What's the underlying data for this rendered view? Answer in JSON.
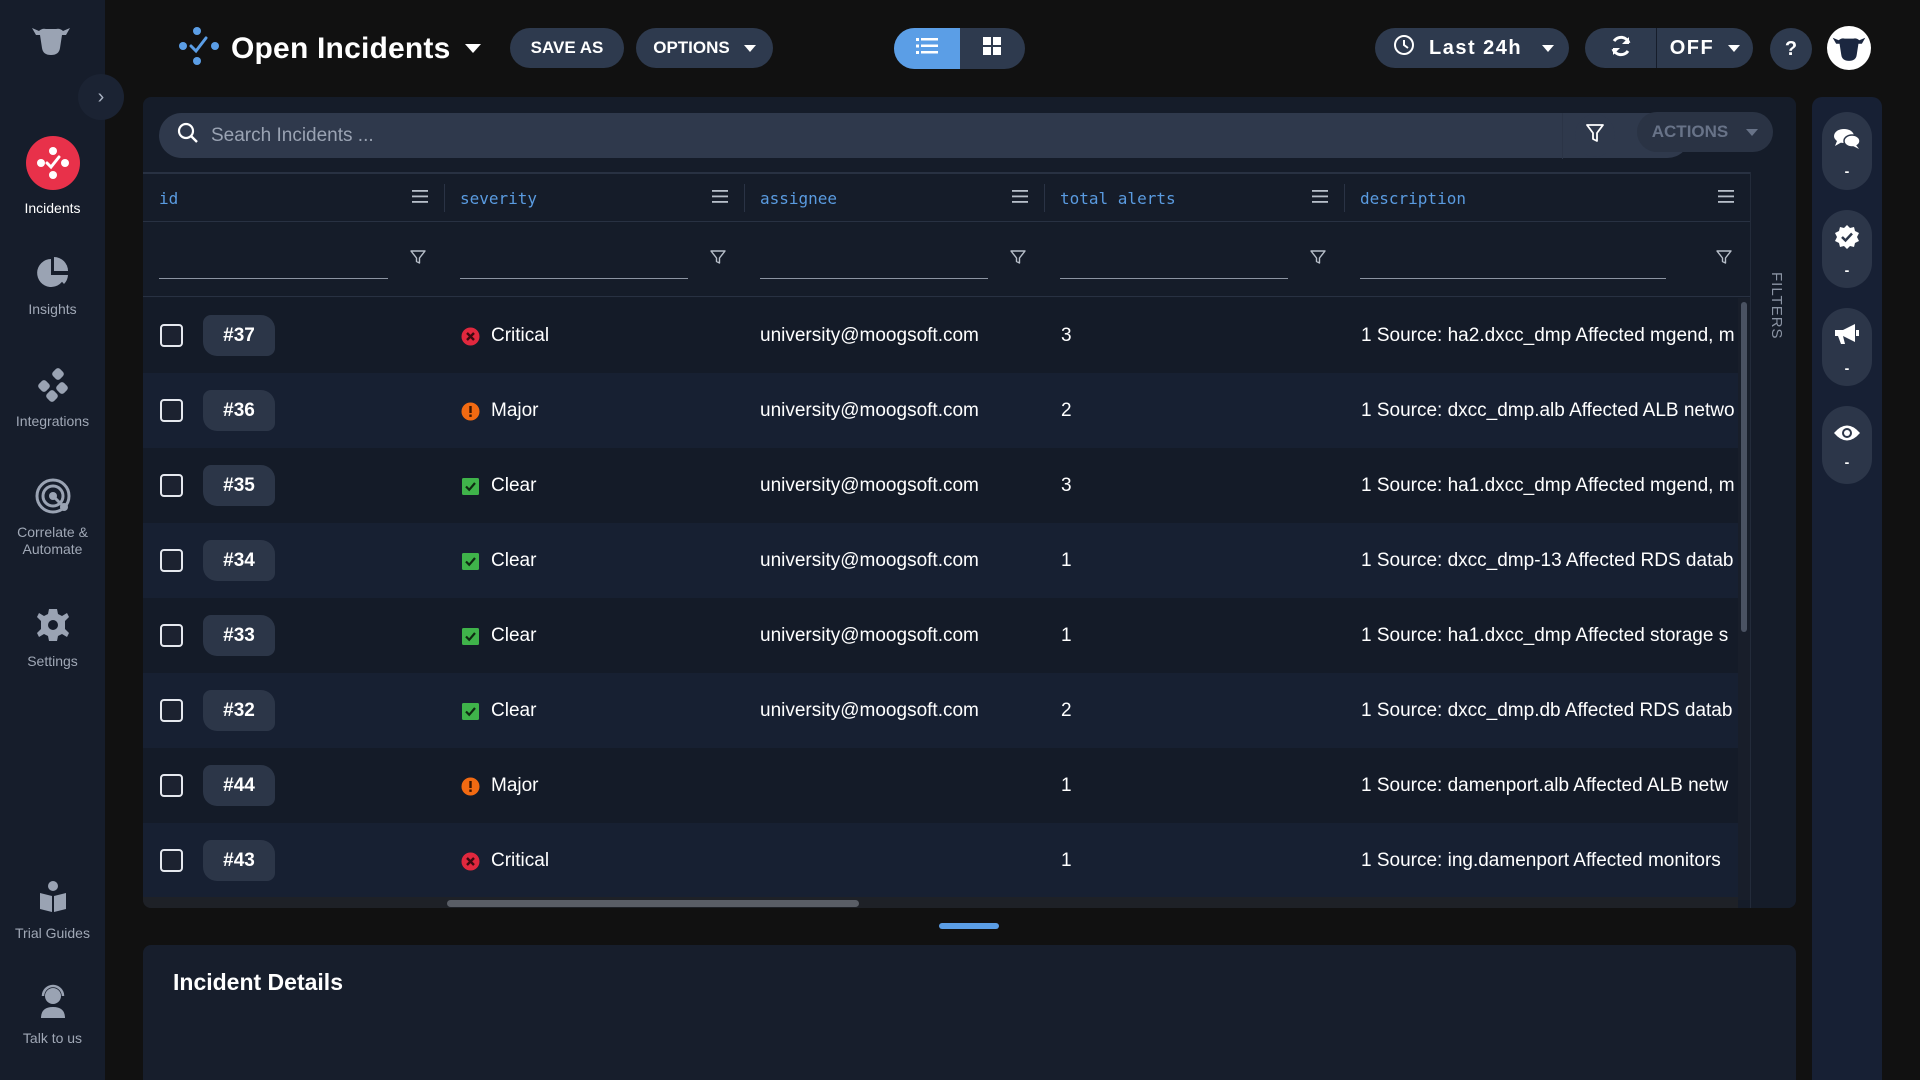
{
  "sidebar": {
    "collapse_icon": "chevron-right-icon",
    "items": [
      {
        "label": "Incidents",
        "icon": "incidents-icon",
        "active": true
      },
      {
        "label": "Insights",
        "icon": "pie-chart-icon",
        "active": false
      },
      {
        "label": "Integrations",
        "icon": "integrations-icon",
        "active": false
      },
      {
        "label": "Correlate &",
        "label2": "Automate",
        "icon": "radar-icon",
        "active": false
      },
      {
        "label": "Settings",
        "icon": "gear-icon",
        "active": false
      },
      {
        "label": "Trial Guides",
        "icon": "book-reader-icon",
        "active": false
      },
      {
        "label": "Talk to us",
        "icon": "headset-icon",
        "active": false
      }
    ]
  },
  "header": {
    "title": "Open Incidents",
    "save_as_label": "SAVE AS",
    "options_label": "OPTIONS",
    "view_modes": [
      "list",
      "grid"
    ],
    "active_view": "list",
    "time_range": "Last 24h",
    "refresh_state": "OFF",
    "help_label": "?"
  },
  "search": {
    "placeholder": "Search Incidents ...",
    "value": ""
  },
  "toolbar": {
    "actions_label": "ACTIONS"
  },
  "table": {
    "columns": [
      "id",
      "severity",
      "assignee",
      "total alerts",
      "description"
    ],
    "rows": [
      {
        "id": "#37",
        "severity": "Critical",
        "assignee": "university@moogsoft.com",
        "total_alerts": "3",
        "description": "1 Source: ha2.dxcc_dmp Affected mgend, m"
      },
      {
        "id": "#36",
        "severity": "Major",
        "assignee": "university@moogsoft.com",
        "total_alerts": "2",
        "description": "1 Source: dxcc_dmp.alb Affected ALB netwo"
      },
      {
        "id": "#35",
        "severity": "Clear",
        "assignee": "university@moogsoft.com",
        "total_alerts": "3",
        "description": "1 Source: ha1.dxcc_dmp Affected mgend, m"
      },
      {
        "id": "#34",
        "severity": "Clear",
        "assignee": "university@moogsoft.com",
        "total_alerts": "1",
        "description": "1 Source: dxcc_dmp-13 Affected RDS datab"
      },
      {
        "id": "#33",
        "severity": "Clear",
        "assignee": "university@moogsoft.com",
        "total_alerts": "1",
        "description": "1 Source: ha1.dxcc_dmp Affected storage s"
      },
      {
        "id": "#32",
        "severity": "Clear",
        "assignee": "university@moogsoft.com",
        "total_alerts": "2",
        "description": "1 Source: dxcc_dmp.db Affected RDS datab"
      },
      {
        "id": "#44",
        "severity": "Major",
        "assignee": "",
        "total_alerts": "1",
        "description": "1 Source: damenport.alb Affected ALB netw"
      },
      {
        "id": "#43",
        "severity": "Critical",
        "assignee": "",
        "total_alerts": "1",
        "description": "1 Source: ing.damenport Affected monitors"
      }
    ]
  },
  "filters_tab_label": "FILTERS",
  "details": {
    "title": "Incident Details"
  },
  "right_rail": [
    {
      "icon": "comments-icon",
      "value": "-"
    },
    {
      "icon": "verified-badge-icon",
      "value": "-"
    },
    {
      "icon": "megaphone-icon",
      "value": "-"
    },
    {
      "icon": "eye-icon",
      "value": "-"
    }
  ],
  "colors": {
    "accent": "#5b9ee6",
    "active_nav": "#e8314a",
    "critical": "#e0283e",
    "major": "#f26a12",
    "clear": "#3fb34a",
    "column_header": "#5a9be0"
  }
}
